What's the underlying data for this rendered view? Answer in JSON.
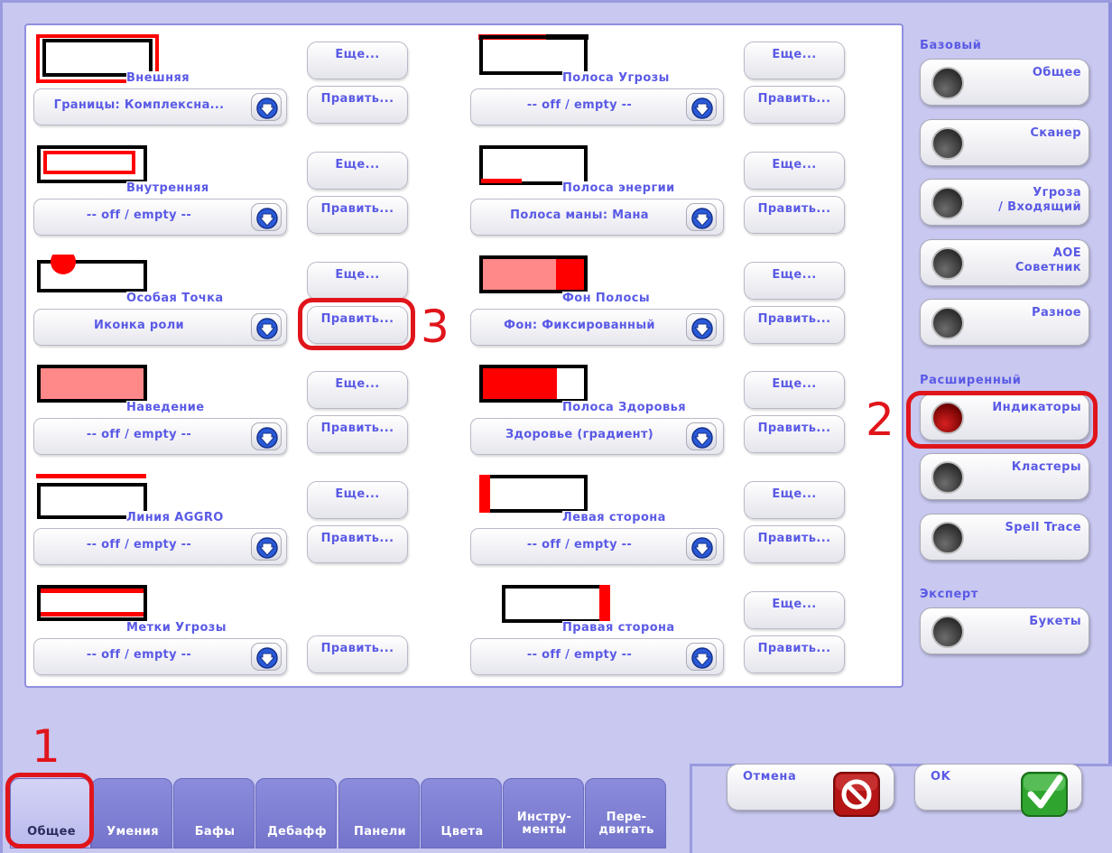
{
  "accent_color": "#5a5ae6",
  "annotation_color": "#e0151b",
  "left_column": [
    {
      "label": "Внешняя",
      "dropdown": "Границы: Комплексна...",
      "more_label": "Еще...",
      "edit_label": "Править...",
      "preview": "outer-border"
    },
    {
      "label": "Внутренняя",
      "dropdown": "-- off / empty --",
      "more_label": "Еще...",
      "edit_label": "Править...",
      "preview": "inner-border"
    },
    {
      "label": "Особая Точка",
      "dropdown": "Иконка роли",
      "more_label": "Еще...",
      "edit_label": "Править...",
      "preview": "special-point"
    },
    {
      "label": "Наведение",
      "dropdown": "-- off / empty --",
      "more_label": "Еще...",
      "edit_label": "Править...",
      "preview": "hover"
    },
    {
      "label": "Линия AGGRO",
      "dropdown": "-- off / empty --",
      "more_label": "Еще...",
      "edit_label": "Править...",
      "preview": "aggro-line"
    },
    {
      "label": "Метки Угрозы",
      "dropdown": "-- off / empty --",
      "more_label": "",
      "edit_label": "Править...",
      "preview": "threat-marks"
    }
  ],
  "right_column": [
    {
      "label": "Полоса Угрозы",
      "dropdown": "-- off / empty --",
      "more_label": "Еще...",
      "edit_label": "Править...",
      "preview": "threat-bar"
    },
    {
      "label": "Полоса энергии",
      "dropdown": "Полоса маны: Мана",
      "more_label": "Еще...",
      "edit_label": "Править...",
      "preview": "energy-bar"
    },
    {
      "label": "Фон Полосы",
      "dropdown": "Фон: Фиксированный",
      "more_label": "Еще...",
      "edit_label": "Править...",
      "preview": "bar-background"
    },
    {
      "label": "Полоса Здоровья",
      "dropdown": "Здоровье (градиент)",
      "more_label": "Еще...",
      "edit_label": "Править...",
      "preview": "health-bar"
    },
    {
      "label": "Левая сторона",
      "dropdown": "-- off / empty --",
      "more_label": "Еще...",
      "edit_label": "Править...",
      "preview": "left-side"
    },
    {
      "label": "Правая сторона",
      "dropdown": "-- off / empty --",
      "more_label": "Еще...",
      "edit_label": "Править...",
      "preview": "right-side"
    }
  ],
  "sidebar": {
    "basic_heading": "Базовый",
    "advanced_heading": "Расширенный",
    "expert_heading": "Эксперт",
    "basic": [
      "Общее",
      "Сканер",
      "Угроза\n/ Входящий",
      "AOE\nСоветник",
      "Разное"
    ],
    "advanced": [
      "Индикаторы",
      "Кластеры",
      "Spell Trace"
    ],
    "expert": [
      "Букеты"
    ],
    "active": "Индикаторы"
  },
  "buttons": {
    "cancel": "Отмена",
    "ok": "OK"
  },
  "tabs": [
    "Общее",
    "Умения",
    "Бафы",
    "Дебафф",
    "Панели",
    "Цвета",
    "Инстру-\nменты",
    "Пере-\nдвигать"
  ],
  "active_tab": "Общее",
  "annotations": [
    "1",
    "2",
    "3"
  ]
}
